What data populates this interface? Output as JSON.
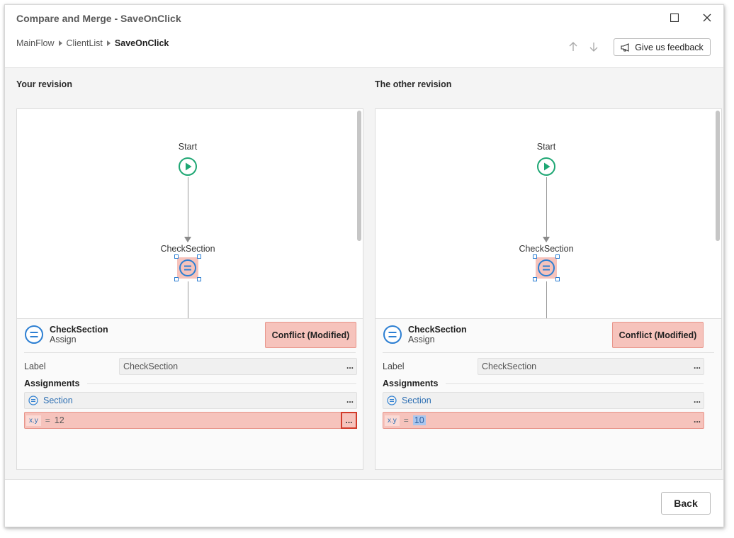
{
  "window": {
    "title": "Compare and Merge - SaveOnClick"
  },
  "breadcrumb": {
    "items": [
      "MainFlow",
      "ClientList"
    ],
    "current": "SaveOnClick"
  },
  "toolbar": {
    "feedback_label": "Give us feedback"
  },
  "left": {
    "title": "Your revision",
    "start_label": "Start",
    "node_label": "CheckSection",
    "node_name": "CheckSection",
    "node_kind": "Assign",
    "conflict_label": "Conflict (Modified)",
    "label_caption": "Label",
    "label_value": "CheckSection",
    "assignments_title": "Assignments",
    "section_label": "Section",
    "var_name": "x.y",
    "eq": "=",
    "value": "12",
    "dots": "..."
  },
  "right": {
    "title": "The other revision",
    "start_label": "Start",
    "node_label": "CheckSection",
    "node_name": "CheckSection",
    "node_kind": "Assign",
    "conflict_label": "Conflict (Modified)",
    "label_caption": "Label",
    "label_value": "CheckSection",
    "assignments_title": "Assignments",
    "section_label": "Section",
    "var_name": "x.y",
    "eq": "=",
    "value": "10",
    "dots": "..."
  },
  "footer": {
    "back_label": "Back"
  },
  "colors": {
    "conflict_bg": "#f6c3bc",
    "accent_blue": "#2d7fd2",
    "start_green": "#1fa774"
  }
}
